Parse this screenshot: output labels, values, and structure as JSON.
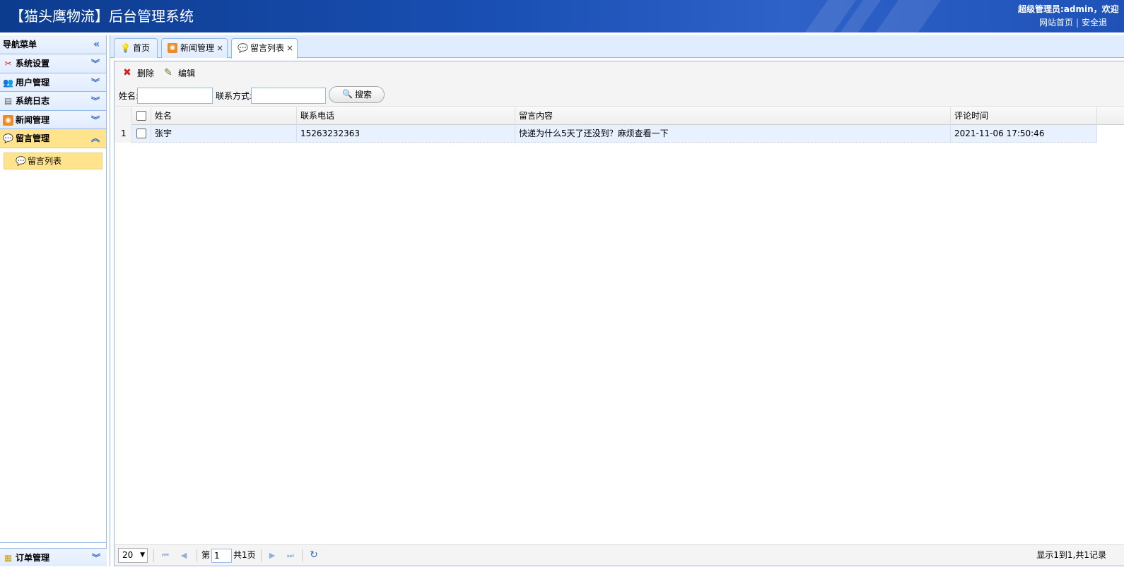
{
  "header": {
    "title": "【猫头鹰物流】后台管理系统",
    "user_info": "超级管理员:admin，欢迎",
    "link_home": "网站首页",
    "link_sep": "|",
    "link_logout": "安全退"
  },
  "sidebar": {
    "title": "导航菜单",
    "sections": [
      {
        "label": "系统设置",
        "icon": "tools-icon"
      },
      {
        "label": "用户管理",
        "icon": "users-icon"
      },
      {
        "label": "系统日志",
        "icon": "log-icon"
      },
      {
        "label": "新闻管理",
        "icon": "rss-icon"
      },
      {
        "label": "留言管理",
        "icon": "comment-icon"
      }
    ],
    "active_section": "留言管理",
    "submenu": {
      "label": "留言列表",
      "icon": "comment-icon"
    },
    "bottom_section": {
      "label": "订单管理",
      "icon": "order-icon"
    }
  },
  "tabs": [
    {
      "label": "首页",
      "icon": "bulb-icon",
      "closable": false
    },
    {
      "label": "新闻管理",
      "icon": "rss-icon",
      "closable": true
    },
    {
      "label": "留言列表",
      "icon": "comment-icon",
      "closable": true,
      "active": true
    }
  ],
  "tab_close_glyph": "×",
  "toolbar": {
    "delete_label": "删除",
    "edit_label": "编辑",
    "name_label": "姓名:",
    "name_value": "",
    "contact_label": "联系方式:",
    "contact_value": "",
    "search_label": "搜索"
  },
  "grid": {
    "columns": [
      "姓名",
      "联系电话",
      "留言内容",
      "评论时间"
    ],
    "rows": [
      {
        "num": "1",
        "name": "张宇",
        "phone": "15263232363",
        "content": "快递为什么5天了还没到？麻烦查看一下",
        "time": "2021-11-06 17:50:46"
      }
    ]
  },
  "pager": {
    "page_size": "20",
    "page_label_pre": "第",
    "page_value": "1",
    "page_label_post": "共1页",
    "info": "显示1到1,共1记录"
  },
  "colors": {
    "header_bg": "#1a4fb4",
    "panel_border": "#95b8e7",
    "active_yellow": "#ffe48d",
    "row_highlight": "#e8f1ff"
  }
}
